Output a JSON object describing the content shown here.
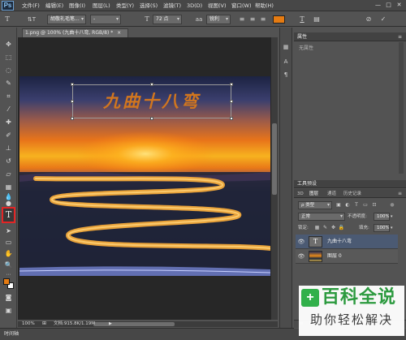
{
  "app": {
    "logo": "Ps"
  },
  "menu": [
    "文件(F)",
    "编辑(E)",
    "图像(I)",
    "图层(L)",
    "类型(Y)",
    "选择(S)",
    "滤镜(T)",
    "3D(D)",
    "视图(V)",
    "窗口(W)",
    "帮助(H)"
  ],
  "window_controls": {
    "minimize": "—",
    "restore": "□",
    "close": "✕"
  },
  "options_bar": {
    "tool_icon": "T",
    "orient_icon": "⇅T",
    "font_family": "胡敬礼毛笔...",
    "font_style": "-",
    "size_icon": "T",
    "font_size": "72 点",
    "aa_label": "aa",
    "aa_value": "锐利",
    "align": [
      "≡",
      "≡",
      "≡"
    ],
    "text_color": "#e57b12",
    "warp_icon": "T",
    "panels_icon": "▤",
    "cancel_icon": "⊘",
    "commit_icon": "✓"
  },
  "document": {
    "tab": "1.png @ 100% (九曲十八弯, RGB/8) *",
    "tab_close": "×",
    "overlay_text": "九曲十八弯",
    "zoom": "100%",
    "doc_info": "文档:915.8K/1.19M"
  },
  "timeline": {
    "label": "时间轴"
  },
  "properties": {
    "title": "属性",
    "empty": "无属性"
  },
  "tool_presets": {
    "title": "工具预设"
  },
  "layers": {
    "tabs": [
      "3D",
      "图层",
      "通道",
      "历史记录"
    ],
    "filter": "ρ 类型",
    "blend_mode": "正常",
    "opacity_label": "不透明度:",
    "opacity_value": "100%",
    "lock_label": "锁定:",
    "fill_label": "填充:",
    "fill_value": "100%",
    "items": [
      {
        "name": "九曲十八弯",
        "thumb": "T",
        "eye": "👁"
      },
      {
        "name": "图层 0",
        "eye": "👁"
      }
    ],
    "footer_icons": [
      "∞",
      "fx",
      "◐",
      "⊙",
      "▭",
      "⊞",
      "🗑"
    ]
  },
  "watermark": {
    "logo": "+",
    "title": "百科全说",
    "subtitle": "助你轻松解决"
  },
  "colors": {
    "foreground": "#e57b12",
    "background": "#ffffff",
    "text_tool_highlight": "#e32525"
  }
}
